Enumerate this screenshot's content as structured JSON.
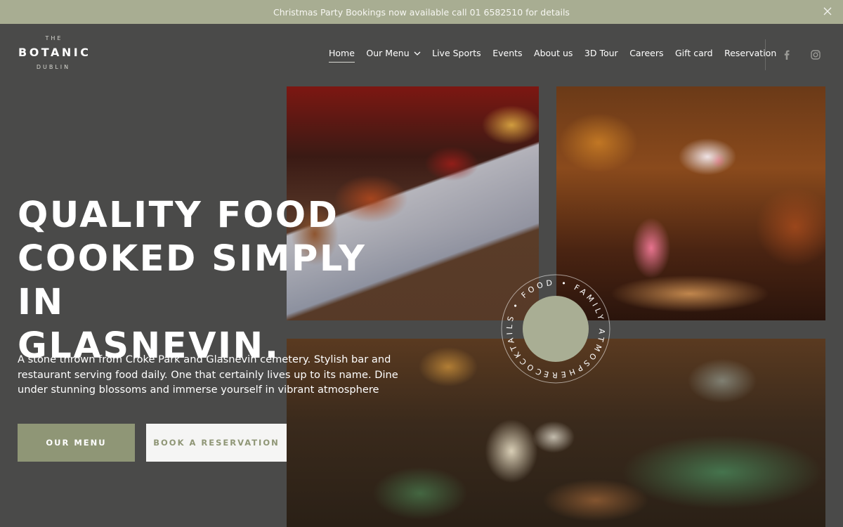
{
  "announcement": {
    "text": "Christmas Party Bookings now available call 01 6582510 for details",
    "close_icon": "close-icon"
  },
  "logo": {
    "top": "THE",
    "name": "BOTANIC",
    "city": "DUBLIN"
  },
  "nav": {
    "items": [
      {
        "label": "Home",
        "active": true
      },
      {
        "label": "Our Menu",
        "has_dropdown": true
      },
      {
        "label": "Live Sports"
      },
      {
        "label": "Events"
      },
      {
        "label": "About us"
      },
      {
        "label": "3D Tour"
      },
      {
        "label": "Careers"
      },
      {
        "label": "Gift card"
      },
      {
        "label": "Reservation"
      }
    ],
    "social": [
      "facebook-icon",
      "instagram-icon"
    ]
  },
  "hero": {
    "headline_lines": [
      "QUALITY FOOD",
      "COOKED SIMPLY IN",
      "GLASNEVIN."
    ],
    "intro": "A stone thrown from Croke Park and Glasnevin cemetery. Stylish bar and restaurant serving food daily. One that certainly lives up to its name. Dine under stunning blossoms and immerse yourself in vibrant atmosphere",
    "buttons": {
      "menu": "OUR MENU",
      "reservation": "BOOK A RESERVATION"
    }
  },
  "badge": {
    "text": "COCKTAILS • FOOD • FAMILY ATMOSPHERE •"
  },
  "colors": {
    "background": "#4a4a49",
    "announcement_bar": "#a8ad92",
    "accent_sage": "#8f9676",
    "badge_circle": "#a9ae94",
    "light_button": "#f5f5f4"
  }
}
